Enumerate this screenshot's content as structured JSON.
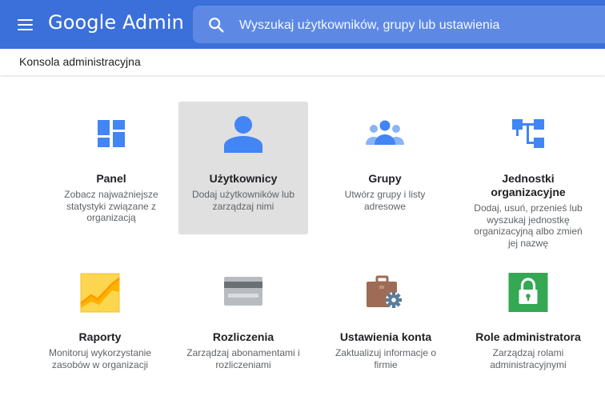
{
  "header": {
    "logo": "Google Admin",
    "search_placeholder": "Wyszukaj użytkowników, grupy lub ustawienia"
  },
  "breadcrumb": "Konsola administracyjna",
  "cards": [
    {
      "title": "Panel",
      "desc": "Zobacz najważniejsze statystyki związane z organizacją",
      "icon": "dashboard-icon"
    },
    {
      "title": "Użytkownicy",
      "desc": "Dodaj użytkowników lub zarządzaj nimi",
      "icon": "user-icon"
    },
    {
      "title": "Grupy",
      "desc": "Utwórz grupy i listy adresowe",
      "icon": "groups-icon"
    },
    {
      "title": "Jednostki organizacyjne",
      "desc": "Dodaj, usuń, przenieś lub wyszukaj jednostkę organizacyjną albo zmień jej nazwę",
      "icon": "org-units-icon"
    },
    {
      "title": "Raporty",
      "desc": "Monitoruj wykorzystanie zasobów w organizacji",
      "icon": "reports-chart-icon"
    },
    {
      "title": "Rozliczenia",
      "desc": "Zarządzaj abonamentami i rozliczeniami",
      "icon": "credit-card-icon"
    },
    {
      "title": "Ustawienia konta",
      "desc": "Zaktualizuj informacje o firmie",
      "icon": "briefcase-gear-icon"
    },
    {
      "title": "Role administratora",
      "desc": "Zarządzaj rolami administracyjnymi",
      "icon": "lock-icon"
    }
  ],
  "colors": {
    "topbar": "#3b6fd9",
    "search_bg": "#5d89e4",
    "icon_blue": "#4285f4",
    "hover_card": "#e0e0e0"
  }
}
